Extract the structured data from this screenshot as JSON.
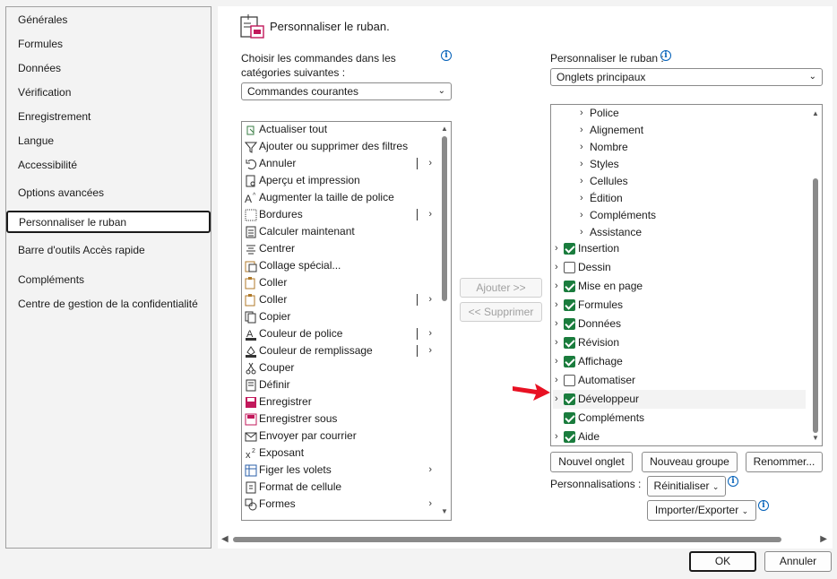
{
  "nav": {
    "items": [
      {
        "label": "Générales"
      },
      {
        "label": "Formules"
      },
      {
        "label": "Données"
      },
      {
        "label": "Vérification"
      },
      {
        "label": "Enregistrement"
      },
      {
        "label": "Langue"
      },
      {
        "label": "Accessibilité"
      },
      {
        "label": "Options avancées"
      },
      {
        "label": "Personnaliser le ruban"
      },
      {
        "label": "Barre d'outils Accès rapide"
      },
      {
        "label": "Compléments"
      },
      {
        "label": "Centre de gestion de la confidentialité"
      }
    ],
    "selected": "Personnaliser le ruban"
  },
  "header": {
    "title": "Personnaliser le ruban."
  },
  "left_panel": {
    "label_line1": "Choisir les commandes dans les",
    "label_line2": "catégories suivantes :",
    "combo_value": "Commandes courantes",
    "commands": [
      {
        "label": "Actualiser tout",
        "icon": "refresh-icon"
      },
      {
        "label": "Ajouter ou supprimer des filtres",
        "icon": "filter-icon"
      },
      {
        "label": "Annuler",
        "icon": "undo-icon",
        "submenu": true,
        "bar": true
      },
      {
        "label": "Aperçu et impression",
        "icon": "print-preview-icon"
      },
      {
        "label": "Augmenter la taille de police",
        "icon": "font-grow-icon"
      },
      {
        "label": "Bordures",
        "icon": "borders-icon",
        "submenu": true,
        "bar": true
      },
      {
        "label": "Calculer maintenant",
        "icon": "calculator-icon"
      },
      {
        "label": "Centrer",
        "icon": "align-center-icon"
      },
      {
        "label": "Collage spécial...",
        "icon": "paste-special-icon"
      },
      {
        "label": "Coller",
        "icon": "paste-icon"
      },
      {
        "label": "Coller",
        "icon": "paste-icon",
        "submenu": true,
        "bar": true
      },
      {
        "label": "Copier",
        "icon": "copy-icon"
      },
      {
        "label": "Couleur de police",
        "icon": "font-color-icon",
        "submenu": true,
        "bar": true
      },
      {
        "label": "Couleur de remplissage",
        "icon": "fill-color-icon",
        "submenu": true,
        "bar": true
      },
      {
        "label": "Couper",
        "icon": "scissors-icon"
      },
      {
        "label": "Définir",
        "icon": "define-icon"
      },
      {
        "label": "Enregistrer",
        "icon": "save-icon"
      },
      {
        "label": "Enregistrer sous",
        "icon": "save-as-icon"
      },
      {
        "label": "Envoyer par courrier",
        "icon": "mail-icon"
      },
      {
        "label": "Exposant",
        "icon": "superscript-icon"
      },
      {
        "label": "Figer les volets",
        "icon": "freeze-panes-icon",
        "submenu": true
      },
      {
        "label": "Format de cellule",
        "icon": "format-cells-icon"
      },
      {
        "label": "Formes",
        "icon": "shapes-icon",
        "submenu": true
      }
    ]
  },
  "middle": {
    "add_label": "Ajouter >>",
    "remove_label": "<< Supprimer"
  },
  "right_panel": {
    "label": "Personnaliser le ruban :",
    "combo_value": "Onglets principaux",
    "groups": [
      {
        "label": "Police"
      },
      {
        "label": "Alignement"
      },
      {
        "label": "Nombre"
      },
      {
        "label": "Styles"
      },
      {
        "label": "Cellules"
      },
      {
        "label": "Édition"
      },
      {
        "label": "Compléments"
      },
      {
        "label": "Assistance"
      }
    ],
    "tabs": [
      {
        "label": "Insertion",
        "checked": true,
        "expander": true
      },
      {
        "label": "Dessin",
        "checked": false,
        "expander": true
      },
      {
        "label": "Mise en page",
        "checked": true,
        "expander": true
      },
      {
        "label": "Formules",
        "checked": true,
        "expander": true
      },
      {
        "label": "Données",
        "checked": true,
        "expander": true
      },
      {
        "label": "Révision",
        "checked": true,
        "expander": true
      },
      {
        "label": "Affichage",
        "checked": true,
        "expander": true
      },
      {
        "label": "Automatiser",
        "checked": false,
        "expander": true
      },
      {
        "label": "Développeur",
        "checked": true,
        "expander": true,
        "highlighted": true
      },
      {
        "label": "Compléments",
        "checked": true,
        "expander": false
      },
      {
        "label": "Aide",
        "checked": true,
        "expander": true
      }
    ],
    "new_tab_label": "Nouvel onglet",
    "new_group_label": "Nouveau groupe",
    "rename_label": "Renommer...",
    "customizations_label": "Personnalisations :",
    "reset_label": "Réinitialiser",
    "import_export_label": "Importer/Exporter"
  },
  "footer": {
    "ok_label": "OK",
    "cancel_label": "Annuler"
  },
  "colors": {
    "accent": "#005fb8",
    "check": "#1a7c3d",
    "arrow": "#e81123"
  }
}
